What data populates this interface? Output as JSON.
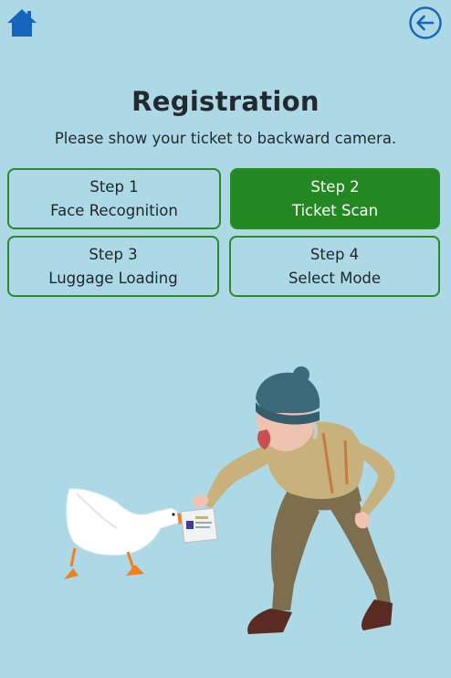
{
  "header": {
    "title": "Registration",
    "subtitle": "Please show your ticket to backward camera."
  },
  "steps": [
    {
      "step": "Step 1",
      "label": "Face Recognition",
      "active": false
    },
    {
      "step": "Step 2",
      "label": "Ticket Scan",
      "active": true
    },
    {
      "step": "Step 3",
      "label": "Luggage Loading",
      "active": false
    },
    {
      "step": "Step 4",
      "label": "Select Mode",
      "active": false
    }
  ],
  "icons": {
    "home": "home-icon",
    "back": "back-arrow-icon"
  },
  "colors": {
    "background": "#add8e6",
    "accent": "#248822",
    "icon": "#1565c0"
  }
}
